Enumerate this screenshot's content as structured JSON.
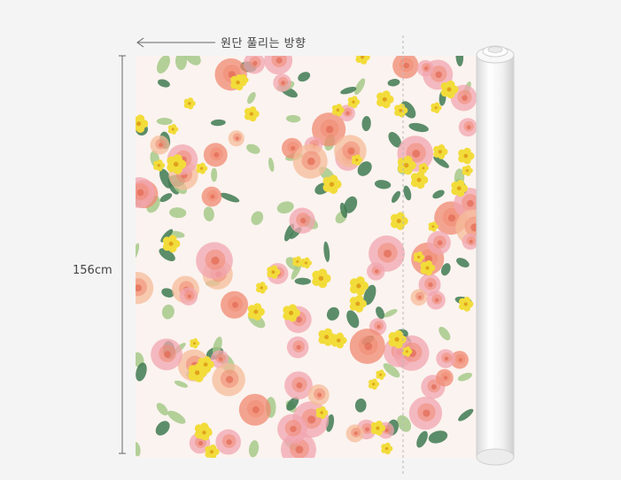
{
  "direction_label": "원단 풀리는 방향",
  "width_label": "156cm",
  "colors": {
    "background": "#f4f4f4",
    "fabric_base": "#fbf3ef",
    "pink": "#f2a5b0",
    "coral": "#f08a72",
    "peach": "#f6bc9a",
    "yellow": "#f2dc3a",
    "leaf": "#3f7a52",
    "light_leaf": "#a6c98a"
  },
  "icons": {
    "arrow": "arrow-left-icon",
    "roll": "fabric-roll-icon"
  }
}
